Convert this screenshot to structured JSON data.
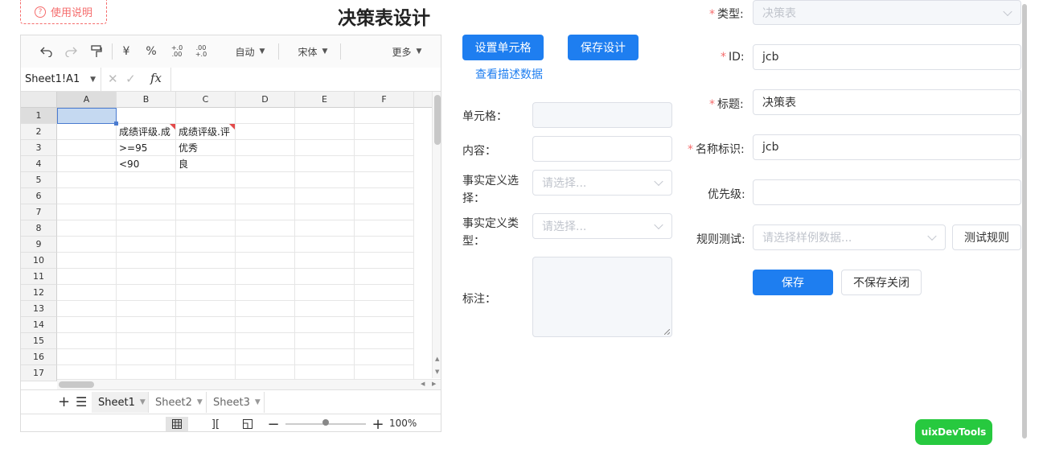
{
  "help_label": "使用说明",
  "page_title": "决策表设计",
  "toolbar": {
    "currency": "¥",
    "percent": "%",
    "dec_add": "+.0",
    "dec_add_sub": ".00",
    "dec_remove": ".00",
    "dec_remove_sub": "+.0",
    "format_label": "自动",
    "font_label": "宋体",
    "more_label": "更多"
  },
  "formula": {
    "cell_ref": "Sheet1!A1",
    "fx": "fx"
  },
  "columns": [
    "A",
    "B",
    "C",
    "D",
    "E",
    "F"
  ],
  "rows": [
    "1",
    "2",
    "3",
    "4",
    "5",
    "6",
    "7",
    "8",
    "9",
    "10",
    "11",
    "12",
    "13",
    "14",
    "15",
    "16",
    "17"
  ],
  "cells": {
    "B2": "成绩评级.成",
    "C2": "成绩评级.评",
    "B3": ">=95",
    "C3": "优秀",
    "B4": "<90",
    "C4": "良"
  },
  "sheet_tabs": [
    "Sheet1",
    "Sheet2",
    "Sheet3"
  ],
  "zoom": "100%",
  "middle": {
    "set_cell_btn": "设置单元格",
    "save_design_btn": "保存设计",
    "view_desc_link": "查看描述数据",
    "cell_label": "单元格：",
    "content_label": "内容：",
    "fact_def_select_label_1": "事实定义选",
    "fact_def_select_label_2": "择：",
    "fact_def_type_label_1": "事实定义类",
    "fact_def_type_label_2": "型：",
    "select_placeholder": "请选择...",
    "note_label": "标注："
  },
  "right": {
    "type_label": "类型:",
    "type_value": "决策表",
    "id_label": "ID:",
    "id_value": "jcb",
    "title_label": "标题:",
    "title_value": "决策表",
    "name_label": "名称标识:",
    "name_value": "jcb",
    "priority_label": "优先级:",
    "priority_value": "",
    "rule_test_label": "规则测试:",
    "rule_test_placeholder": "请选择样例数据...",
    "test_rule_btn": "测试规则",
    "save_btn": "保存",
    "close_btn": "不保存关闭",
    "required_mark": "*"
  },
  "devtools_label": "uixDevTools",
  "colors": {
    "primary": "#1e7ef0",
    "required": "#f56c6c",
    "devtools": "#27c93f"
  }
}
